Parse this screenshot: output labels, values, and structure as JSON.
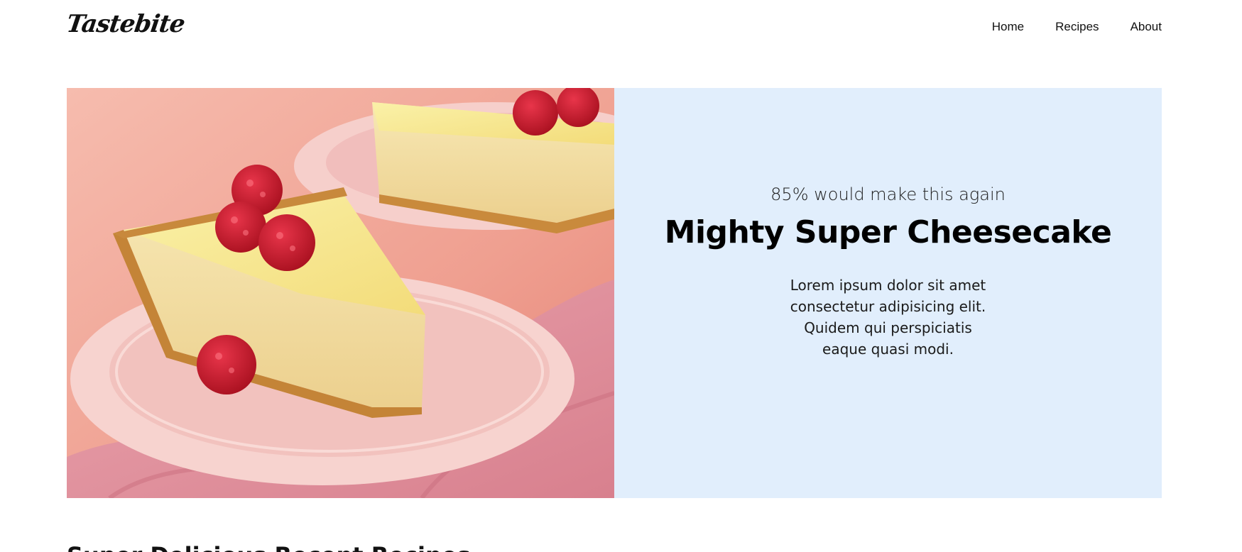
{
  "header": {
    "logo": "Tastebite",
    "nav": [
      {
        "label": "Home"
      },
      {
        "label": "Recipes"
      },
      {
        "label": "About"
      }
    ]
  },
  "hero": {
    "image": {
      "subject": "cheesecake slice with raspberries on pink plates"
    },
    "rating_text": "85% would make this again",
    "title": "Mighty Super Cheesecake",
    "description": "Lorem ipsum dolor sit amet consectetur adipisicing elit. Quidem qui perspiciatis eaque quasi modi.",
    "panel_color": "#e1eefc"
  },
  "next_section": {
    "heading": "Super Delicious Recent Recipes"
  }
}
